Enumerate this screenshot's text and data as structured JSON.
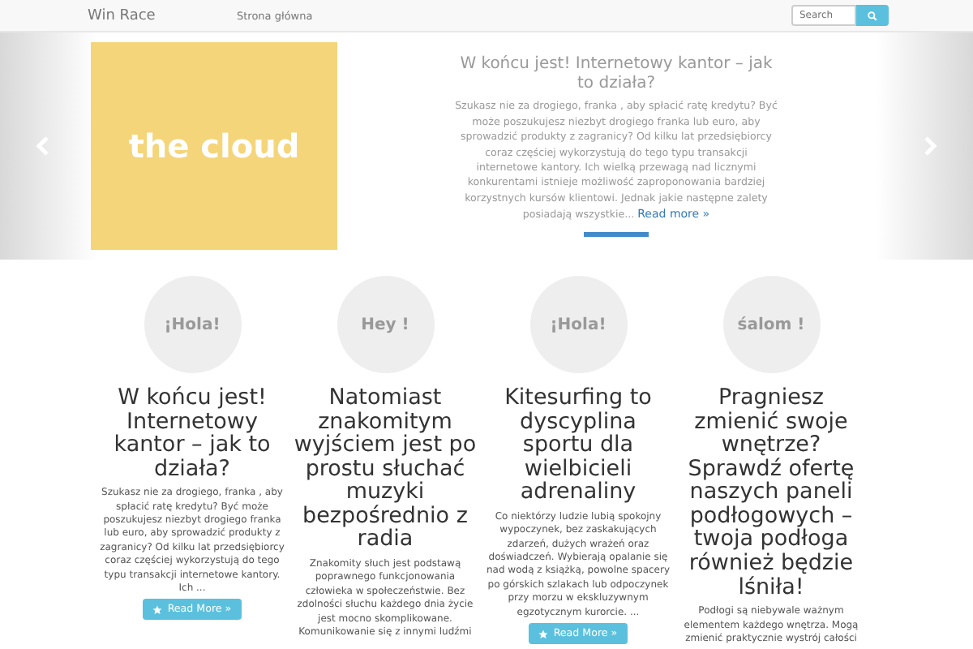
{
  "navbar": {
    "brand": "Win Race",
    "links": [
      {
        "label": "Strona główna",
        "selected": false
      }
    ],
    "search": {
      "placeholder": "Search"
    }
  },
  "hero": {
    "picture_text": "the cloud",
    "title": "W końcu jest! Internetowy kantor – jak to działa?",
    "text": "Szukasz nie za drogiego, franka , aby spłacić ratę kredytu? Być może poszukujesz niezbyt drogiego franka lub euro, aby sprowadzić produkty z zagranicy? Od kilku lat przedsiębiorcy coraz częściej wykorzystują do tego typu transakcji internetowe kantory. Ich wielką przewagą nad licznymi konkurentami istnieje możliwość zaproponowania bardziej korzystnych kursów klientowi. Jednak jakie następne zalety posiadają wszystkie...",
    "link": "Read more »"
  },
  "cards": [
    {
      "badge": "¡Hola!",
      "title": "W końcu jest! Internetowy kantor – jak to działa?",
      "text": "Szukasz nie za drogiego, franka , aby spłacić ratę kredytu? Być może poszukujesz niezbyt drogiego franka lub euro, aby sprowadzić produkty z zagranicy? Od kilku lat przedsiębiorcy coraz częściej wykorzystują do tego typu transakcji internetowe kantory. Ich ...",
      "button": "Read More »"
    },
    {
      "badge": "Hey !",
      "title": "Natomiast znakomitym wyjściem jest po prostu słuchać muzyki bezpośrednio z radia",
      "text": "Znakomity słuch jest podstawą poprawnego funkcjonowania człowieka w społeczeństwie. Bez zdolności słuchu każdego dnia życie jest mocno skomplikowane. Komunikowanie się z innymi ludźmi"
    },
    {
      "badge": "¡Hola!",
      "title": "Kitesurfing to dyscyplina sportu dla wielbicieli adrenaliny",
      "text": "Co niektórzy ludzie lubią spokojny wypoczynek, bez zaskakujących zdarzeń, dużych wrażeń oraz doświadczeń. Wybierają opalanie się nad wodą z książką, powolne spacery po górskich szlakach lub odpoczynek przy morzu w ekskluzywnym egzotycznym kurorcie. ...",
      "button": "Read More »"
    },
    {
      "badge": "śalom !",
      "title": "Pragniesz zmienić swoje wnętrze? Sprawdź ofertę naszych paneli podłogowych – twoja podłoga również będzie lśniła!",
      "text": "Podłogi są niebywale ważnym elementem każdego wnętrza. Mogą zmienić praktycznie wystrój całości"
    }
  ]
}
